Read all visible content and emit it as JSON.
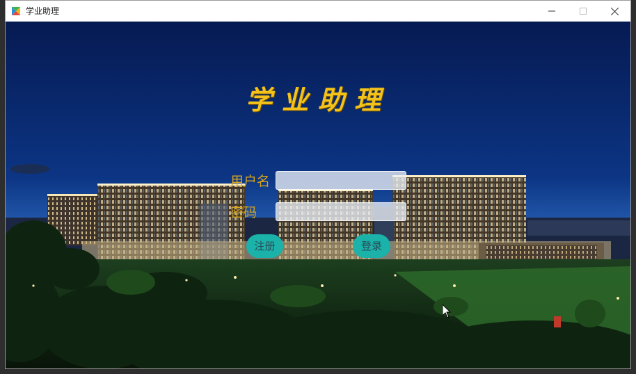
{
  "window": {
    "title": "学业助理",
    "icon": "app-logo-icon",
    "controls": [
      "minimize-icon",
      "maximize-icon",
      "close-icon"
    ]
  },
  "main": {
    "heading": "学业助理",
    "username_label": "用户名",
    "username_value": "",
    "username_placeholder": "",
    "password_label": "密码",
    "password_value": "",
    "password_placeholder": "",
    "register_label": "注册",
    "login_label": "登录"
  },
  "colors": {
    "heading": "#f3c21b",
    "label": "#d9a51c",
    "button": "#1ab2a9",
    "sky_top": "#061a52",
    "sky_bottom": "#2a63b7"
  }
}
